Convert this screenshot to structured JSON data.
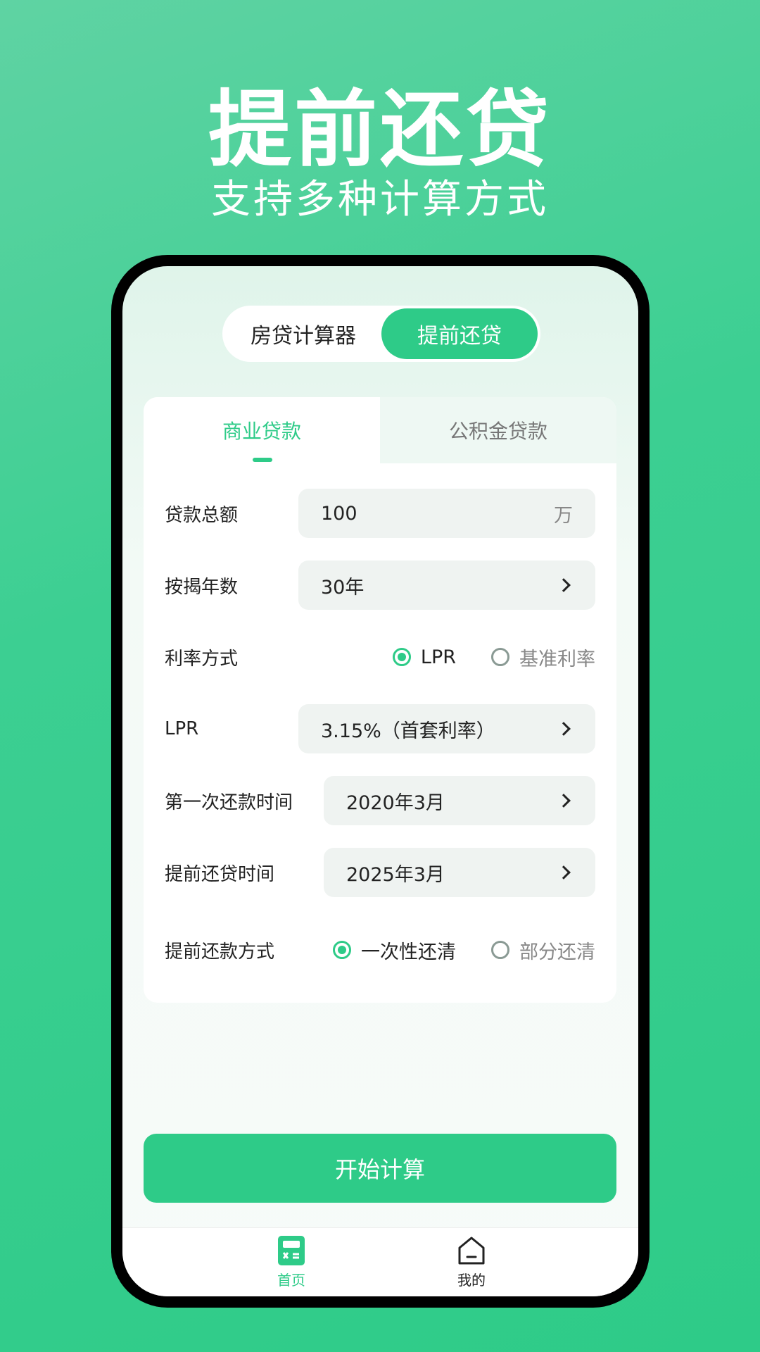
{
  "promo": {
    "title": "提前还贷",
    "subtitle": "支持多种计算方式"
  },
  "segment": {
    "items": [
      {
        "label": "房贷计算器",
        "active": false
      },
      {
        "label": "提前还贷",
        "active": true
      }
    ]
  },
  "loan_tabs": [
    {
      "label": "商业贷款",
      "active": true
    },
    {
      "label": "公积金贷款",
      "active": false
    }
  ],
  "form": {
    "loan_amount": {
      "label": "贷款总额",
      "value": "100",
      "unit": "万"
    },
    "years": {
      "label": "按揭年数",
      "value": "30年"
    },
    "rate_mode": {
      "label": "利率方式",
      "options": [
        {
          "label": "LPR",
          "selected": true
        },
        {
          "label": "基准利率",
          "selected": false
        }
      ]
    },
    "lpr": {
      "label": "LPR",
      "value": "3.15%（首套利率）"
    },
    "first_payment": {
      "label": "第一次还款时间",
      "value": "2020年3月"
    },
    "prepay_time": {
      "label": "提前还贷时间",
      "value": "2025年3月"
    },
    "prepay_mode": {
      "label": "提前还款方式",
      "options": [
        {
          "label": "一次性还清",
          "selected": true
        },
        {
          "label": "部分还清",
          "selected": false
        }
      ]
    }
  },
  "calculate_label": "开始计算",
  "tabbar": {
    "items": [
      {
        "label": "首页",
        "icon": "calculator-icon",
        "active": true
      },
      {
        "label": "我的",
        "icon": "home-icon",
        "active": false
      }
    ]
  },
  "colors": {
    "accent": "#2ecb88",
    "background_gradient": [
      "#5fd3a3",
      "#2ecb88"
    ]
  }
}
